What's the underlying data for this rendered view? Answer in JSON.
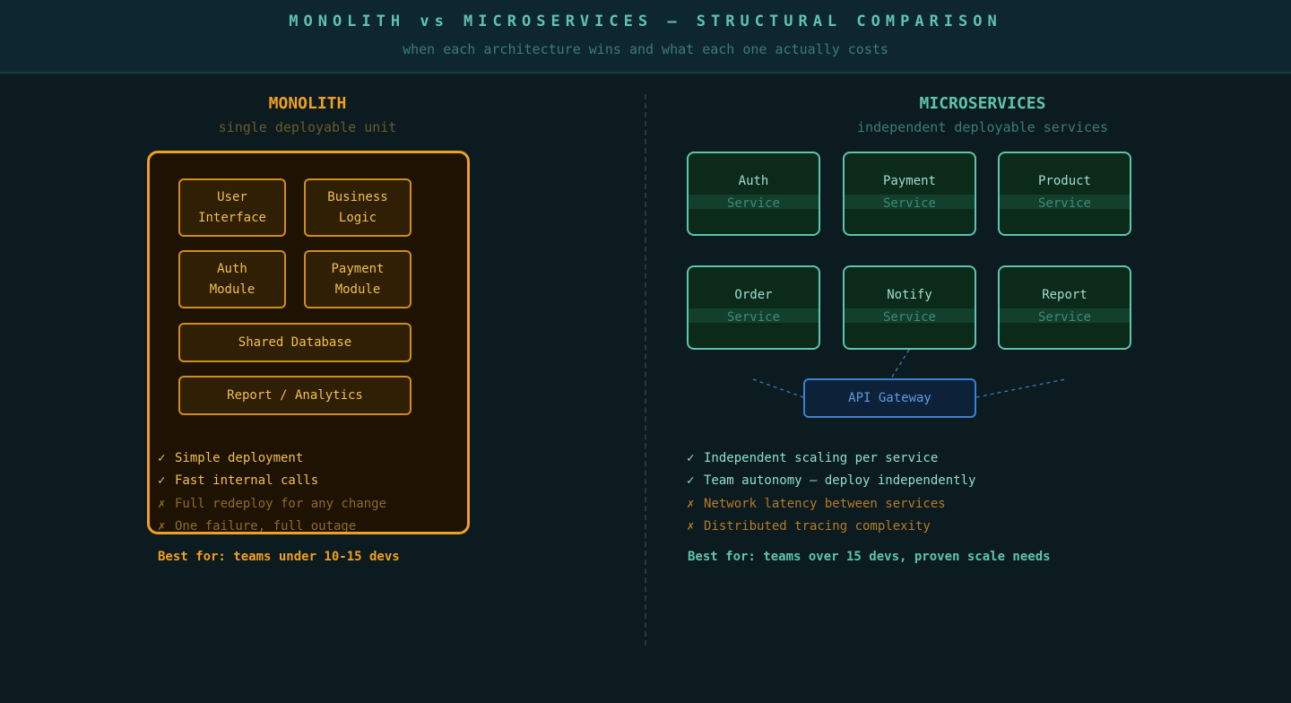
{
  "header": {
    "title": "MONOLITH vs MICROSERVICES — STRUCTURAL COMPARISON",
    "subtitle": "when each architecture wins and what each one actually costs"
  },
  "monolith": {
    "title": "MONOLITH",
    "subtitle": "single deployable unit",
    "modules": {
      "user_interface": [
        "User",
        "Interface"
      ],
      "business_logic": [
        "Business",
        "Logic"
      ],
      "auth_module": [
        "Auth",
        "Module"
      ],
      "payment_module": [
        "Payment",
        "Module"
      ],
      "shared_database": "Shared Database",
      "report_analytics": "Report / Analytics"
    },
    "pros": [
      {
        "mark": "✓",
        "text": "Simple deployment"
      },
      {
        "mark": "✓",
        "text": "Fast internal calls"
      }
    ],
    "cons": [
      {
        "mark": "✗",
        "text": "Full redeploy for any change"
      },
      {
        "mark": "✗",
        "text": "One failure, full outage"
      }
    ],
    "best_for": "Best for: teams under 10-15 devs",
    "colors": {
      "accent": "#f0a020",
      "fill": "#1e1303"
    }
  },
  "microservices": {
    "title": "MICROSERVICES",
    "subtitle": "independent deployable services",
    "services": [
      {
        "name": "Auth",
        "type": "Service"
      },
      {
        "name": "Payment",
        "type": "Service"
      },
      {
        "name": "Product",
        "type": "Service"
      },
      {
        "name": "Order",
        "type": "Service"
      },
      {
        "name": "Notify",
        "type": "Service"
      },
      {
        "name": "Report",
        "type": "Service"
      }
    ],
    "gateway": "API Gateway",
    "pros": [
      {
        "mark": "✓",
        "text": "Independent scaling per service"
      },
      {
        "mark": "✓",
        "text": "Team autonomy — deploy independently"
      }
    ],
    "cons": [
      {
        "mark": "✗",
        "text": "Network latency between services"
      },
      {
        "mark": "✗",
        "text": "Distributed tracing complexity"
      }
    ],
    "best_for": "Best for: teams over 15 devs, proven scale needs",
    "colors": {
      "accent": "#5ec4ac",
      "gateway": "#3b82d0"
    }
  }
}
